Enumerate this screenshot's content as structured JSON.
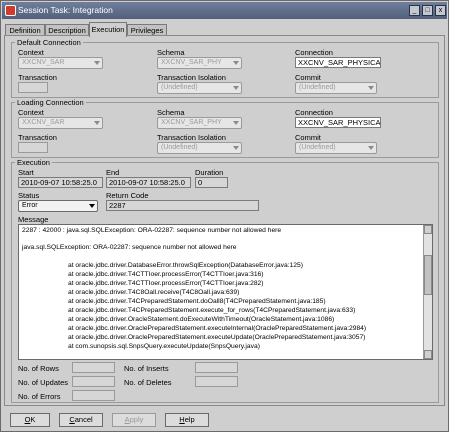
{
  "window": {
    "title": "Session Task: Integration",
    "min_glyph": "_",
    "max_glyph": "□",
    "close_glyph": "x"
  },
  "tabs": [
    {
      "label": "Definition"
    },
    {
      "label": "Description"
    },
    {
      "label": "Execution",
      "active": true
    },
    {
      "label": "Privileges"
    }
  ],
  "default_connection": {
    "title": "Default Connection",
    "context_label": "Context",
    "context_value": "XXCNV_SAR",
    "schema_label": "Schema",
    "schema_value": "XXCNV_SAR_PHY",
    "connection_label": "Connection",
    "connection_value": "XXCNV_SAR_PHYSICAL",
    "transaction_label": "Transaction",
    "transaction_value": "",
    "isolation_label": "Transaction Isolation",
    "isolation_value": "(Undefined)",
    "commit_label": "Commit",
    "commit_value": "(Undefined)"
  },
  "loading_connection": {
    "title": "Loading Connection",
    "context_label": "Context",
    "context_value": "XXCNV_SAR",
    "schema_label": "Schema",
    "schema_value": "XXCNV_SAR_PHY",
    "connection_label": "Connection",
    "connection_value": "XXCNV_SAR_PHYSICAL",
    "transaction_label": "Transaction",
    "transaction_value": "",
    "isolation_label": "Transaction Isolation",
    "isolation_value": "(Undefined)",
    "commit_label": "Commit",
    "commit_value": "(Undefined)"
  },
  "execution": {
    "title": "Execution",
    "start_label": "Start",
    "start_value": "2010-09-07 10:58:25.0",
    "end_label": "End",
    "end_value": "2010-09-07 10:58:25.0",
    "duration_label": "Duration",
    "duration_value": "0",
    "status_label": "Status",
    "status_value": "Error",
    "return_code_label": "Return Code",
    "return_code_value": "2287",
    "message_label": "Message",
    "message_lines": [
      "2287 : 42000 : java.sql.SQLException: ORA-02287: sequence number not allowed here",
      "",
      "java.sql.SQLException: ORA-02287: sequence number not allowed here",
      "",
      "at oracle.jdbc.driver.DatabaseError.throwSqlException(DatabaseError.java:125)",
      "at oracle.jdbc.driver.T4CTTIoer.processError(T4CTTIoer.java:316)",
      "at oracle.jdbc.driver.T4CTTIoer.processError(T4CTTIoer.java:282)",
      "at oracle.jdbc.driver.T4C8Oall.receive(T4C8Oall.java:639)",
      "at oracle.jdbc.driver.T4CPreparedStatement.doOall8(T4CPreparedStatement.java:185)",
      "at oracle.jdbc.driver.T4CPreparedStatement.execute_for_rows(T4CPreparedStatement.java:633)",
      "at oracle.jdbc.driver.OracleStatement.doExecuteWithTimeout(OracleStatement.java:1086)",
      "at oracle.jdbc.driver.OraclePreparedStatement.executeInternal(OraclePreparedStatement.java:2984)",
      "at oracle.jdbc.driver.OraclePreparedStatement.executeUpdate(OraclePreparedStatement.java:3057)",
      "at com.sunopsis.sql.SnpsQuery.executeUpdate(SnpsQuery.java)"
    ],
    "rows_label": "No. of Rows",
    "rows_value": "",
    "inserts_label": "No. of Inserts",
    "inserts_value": "",
    "updates_label": "No. of Updates",
    "updates_value": "",
    "deletes_label": "No. of Deletes",
    "deletes_value": "",
    "errors_label": "No. of Errors",
    "errors_value": ""
  },
  "buttons": {
    "ok_mn": "O",
    "ok_rest": "K",
    "cancel_mn": "C",
    "cancel_rest": "ancel",
    "apply_mn": "A",
    "apply_rest": "pply",
    "help_mn": "H",
    "help_rest": "elp"
  }
}
